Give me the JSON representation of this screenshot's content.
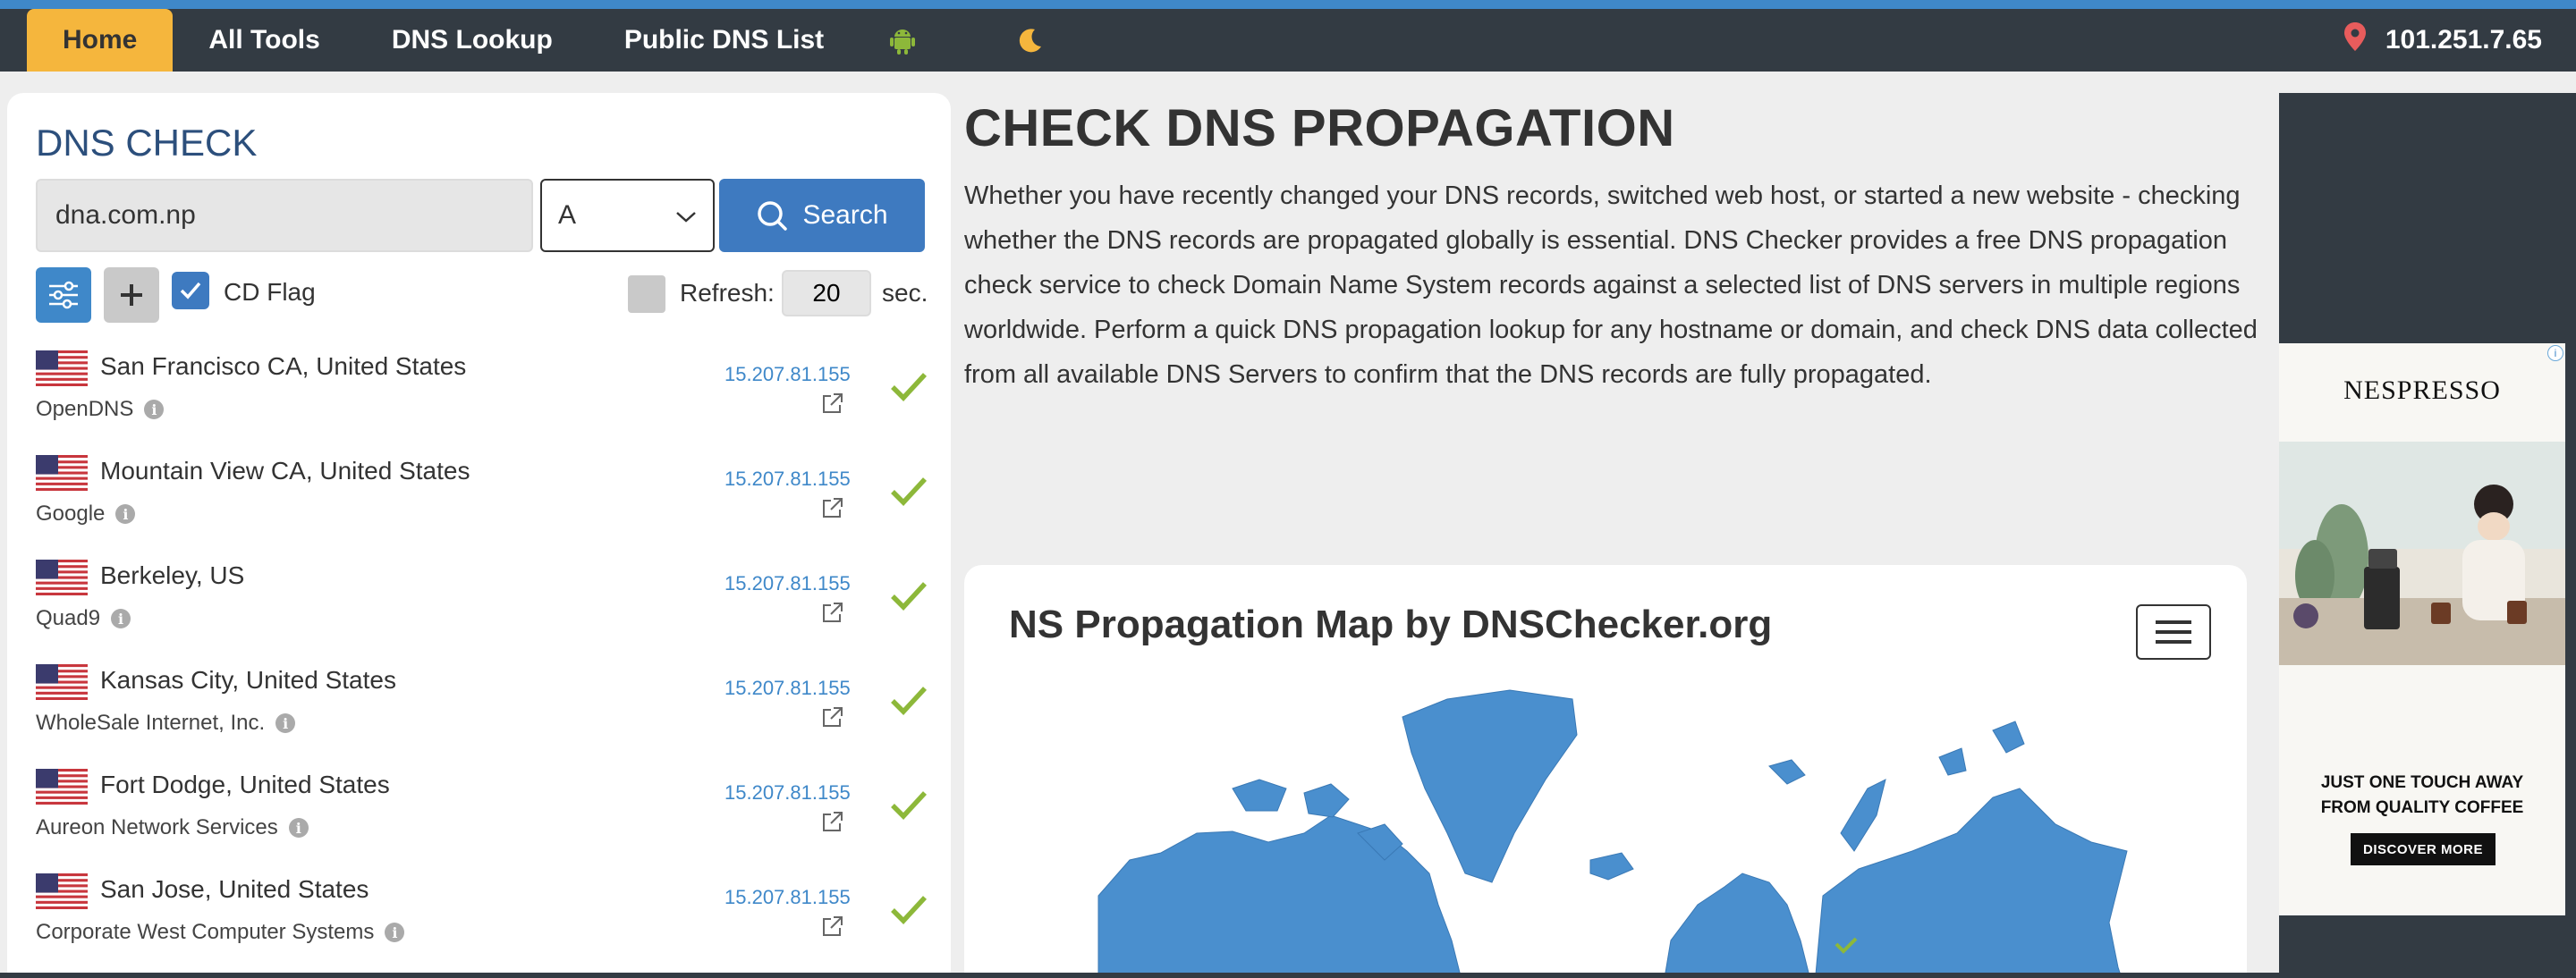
{
  "nav": {
    "items": [
      {
        "label": "Home",
        "active": true
      },
      {
        "label": "All Tools"
      },
      {
        "label": "DNS Lookup"
      },
      {
        "label": "Public DNS List"
      }
    ],
    "android_icon": "android-icon",
    "theme_icon": "moon-icon",
    "location_icon": "map-pin-icon",
    "user_ip": "101.251.7.65"
  },
  "dns_check": {
    "title": "DNS CHECK",
    "domain_value": "dna.com.np",
    "record_type": "A",
    "search_label": "Search",
    "cd_flag_label": "CD Flag",
    "cd_flag_checked": true,
    "refresh_label": "Refresh:",
    "refresh_value": "20",
    "sec_label": "sec.",
    "servers": [
      {
        "location": "San Francisco CA, United States",
        "provider": "OpenDNS",
        "ip": "15.207.81.155",
        "status": "ok"
      },
      {
        "location": "Mountain View CA, United States",
        "provider": "Google",
        "ip": "15.207.81.155",
        "status": "ok"
      },
      {
        "location": "Berkeley, US",
        "provider": "Quad9",
        "ip": "15.207.81.155",
        "status": "ok"
      },
      {
        "location": "Kansas City, United States",
        "provider": "WholeSale Internet, Inc.",
        "ip": "15.207.81.155",
        "status": "ok"
      },
      {
        "location": "Fort Dodge, United States",
        "provider": "Aureon Network Services",
        "ip": "15.207.81.155",
        "status": "ok"
      },
      {
        "location": "San Jose, United States",
        "provider": "Corporate West Computer Systems",
        "ip": "15.207.81.155",
        "status": "ok"
      }
    ]
  },
  "main": {
    "title": "CHECK DNS PROPAGATION",
    "description": "Whether you have recently changed your DNS records, switched web host, or started a new website - checking whether the DNS records are propagated globally is essential. DNS Checker provides a free DNS propagation check service to check Domain Name System records against a selected list of DNS servers in multiple regions worldwide. Perform a quick DNS propagation lookup for any hostname or domain, and check DNS data collected from all available DNS Servers to confirm that the DNS records are fully propagated."
  },
  "map": {
    "title": "NS Propagation Map by DNSChecker.org"
  },
  "ad": {
    "brand": "NESPRESSO",
    "tagline_line1": "JUST ONE TOUCH AWAY",
    "tagline_line2": "FROM QUALITY COFFEE",
    "cta": "DISCOVER MORE"
  },
  "colors": {
    "nav_bg": "#333b43",
    "nav_accent": "#3f88c9",
    "home_tab": "#f5b63d",
    "primary_button": "#3e7ac0",
    "map_land": "#4a8fce",
    "success_check": "#8db83a"
  }
}
